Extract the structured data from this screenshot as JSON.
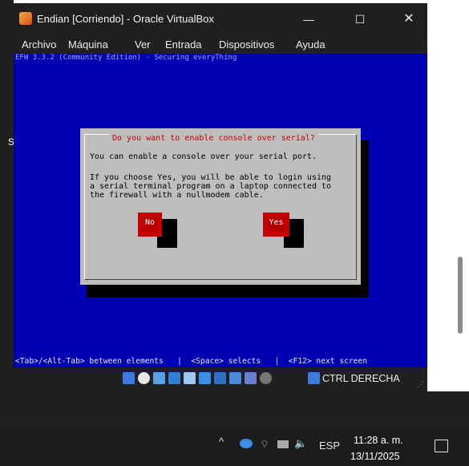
{
  "window": {
    "title": "Endian [Corriendo] - Oracle VirtualBox",
    "minimize": "—",
    "maximize": "☐",
    "close": "✕"
  },
  "menu": {
    "items": [
      {
        "label": "Archivo"
      },
      {
        "label": "Máquina"
      },
      {
        "label": "Ver"
      },
      {
        "label": "Entrada"
      },
      {
        "label": "Dispositivos"
      },
      {
        "label": "Ayuda"
      }
    ]
  },
  "guest": {
    "header": "EFW 3.3.2 (Community Edition) - Securing everyThing",
    "dialog": {
      "title": "Do you want to enable console over serial?",
      "line1": "You can enable a console over your serial port.",
      "line2": "If you choose Yes, you will be able to login using",
      "line3": "a serial terminal program on a laptop connected to",
      "line4": "the firewall with a nullmodem cable.",
      "no_label": "No",
      "yes_label": "Yes"
    },
    "hint": "<Tab>/<Alt-Tab> between elements   |  <Space> selects   |  <F12> next screen"
  },
  "statusbar": {
    "host_key": "CTRL DERECHA"
  },
  "desktop": {
    "side_letter": "s"
  },
  "taskbar": {
    "tray_arrow": "^",
    "language": "ESP",
    "time": "11:28 a. m.",
    "date": "13/11/2025",
    "volume_icon_glyph": "🔈"
  },
  "colors": {
    "guest_bg": "#0000b3",
    "dialog_bg": "#bebebe",
    "dialog_title": "#c40000",
    "button_red": "#c40000"
  }
}
